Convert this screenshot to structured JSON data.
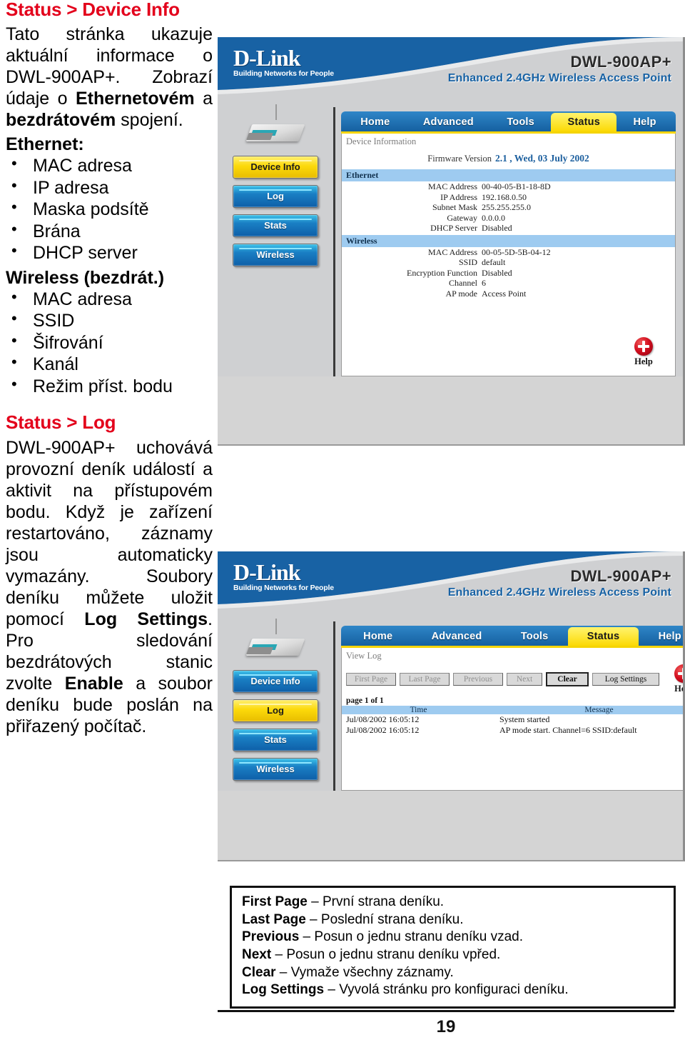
{
  "left_column": {
    "section1": {
      "heading": "Status > Device Info",
      "paragraph_html": "Tato stránka ukazuje aktuální informace o DWL-900AP+. Zobrazí údaje o <b>Ethernetovém</b> a <b>bezdrátovém</b> spojení.",
      "ethernet_heading": "Ethernet:",
      "ethernet_items": [
        "MAC adresa",
        "IP adresa",
        "Maska podsítě",
        "Brána",
        "DHCP server"
      ],
      "wireless_heading": "Wireless (bezdrát.)",
      "wireless_items": [
        "MAC adresa",
        "SSID",
        "Šifrování",
        "Kanál",
        "Režim příst. bodu"
      ]
    },
    "section2": {
      "heading": "Status > Log",
      "paragraph_html": "DWL-900AP+ uchovává provozní deník událostí a aktivit na přístupovém bodu. Když je zařízení restartováno, záznamy jsou automaticky vymazány. Soubory deníku můžete uložit pomocí <b>Log Settings</b>. Pro sledování bezdrátových stanic zvolte <b>Enable</b> a soubor deníku bude poslán na přiřazený počítač."
    }
  },
  "screenshot_device": {
    "brand": {
      "logo_main": "D-Link",
      "logo_tagline": "Building Networks for People"
    },
    "model": {
      "name": "DWL-900AP+",
      "subtitle": "Enhanced 2.4GHz Wireless Access Point"
    },
    "tabs": [
      {
        "label": "Home",
        "active": false
      },
      {
        "label": "Advanced",
        "active": false
      },
      {
        "label": "Tools",
        "active": false
      },
      {
        "label": "Status",
        "active": true
      },
      {
        "label": "Help",
        "active": false
      }
    ],
    "sidebar": [
      {
        "label": "Device Info",
        "active": true
      },
      {
        "label": "Log",
        "active": false
      },
      {
        "label": "Stats",
        "active": false
      },
      {
        "label": "Wireless",
        "active": false
      }
    ],
    "panel_title": "Device Information",
    "firmware_label": "Firmware Version",
    "firmware_value": "2.1 , Wed, 03 July 2002",
    "ethernet_group": "Ethernet",
    "ethernet_rows": [
      {
        "key": "MAC Address",
        "value": "00-40-05-B1-18-8D"
      },
      {
        "key": "IP Address",
        "value": "192.168.0.50"
      },
      {
        "key": "Subnet Mask",
        "value": "255.255.255.0"
      },
      {
        "key": "Gateway",
        "value": "0.0.0.0"
      },
      {
        "key": "DHCP Server",
        "value": "Disabled"
      }
    ],
    "wireless_group": "Wireless",
    "wireless_rows": [
      {
        "key": "MAC Address",
        "value": "00-05-5D-5B-04-12"
      },
      {
        "key": "SSID",
        "value": "default"
      },
      {
        "key": "Encryption Function",
        "value": "Disabled"
      },
      {
        "key": "Channel",
        "value": "6"
      },
      {
        "key": "AP mode",
        "value": "Access Point"
      }
    ],
    "help_label": "Help"
  },
  "screenshot_log": {
    "brand": {
      "logo_main": "D-Link",
      "logo_tagline": "Building Networks for People"
    },
    "model": {
      "name": "DWL-900AP+",
      "subtitle": "Enhanced 2.4GHz Wireless Access Point"
    },
    "tabs": [
      {
        "label": "Home",
        "active": false
      },
      {
        "label": "Advanced",
        "active": false
      },
      {
        "label": "Tools",
        "active": false
      },
      {
        "label": "Status",
        "active": true
      },
      {
        "label": "Help",
        "active": false
      }
    ],
    "sidebar": [
      {
        "label": "Device Info",
        "active": false
      },
      {
        "label": "Log",
        "active": true
      },
      {
        "label": "Stats",
        "active": false
      },
      {
        "label": "Wireless",
        "active": false
      }
    ],
    "panel_title": "View Log",
    "toolbar": [
      {
        "label": "First Page",
        "enabled": false
      },
      {
        "label": "Last Page",
        "enabled": false
      },
      {
        "label": "Previous",
        "enabled": false
      },
      {
        "label": "Next",
        "enabled": false
      },
      {
        "label": "Clear",
        "enabled": true,
        "focused": true
      },
      {
        "label": "Log Settings",
        "enabled": true
      }
    ],
    "page_info": "page 1 of 1",
    "columns": [
      "Time",
      "Message"
    ],
    "rows": [
      {
        "time": "Jul/08/2002 16:05:12",
        "message": "System started"
      },
      {
        "time": "Jul/08/2002 16:05:12",
        "message": "AP mode start. Channel=6 SSID:default"
      }
    ],
    "help_label": "Help"
  },
  "legend": [
    {
      "term": "First Page",
      "dash": " – ",
      "desc": "První strana deníku."
    },
    {
      "term": "Last Page",
      "dash": " – ",
      "desc": "Poslední strana deníku."
    },
    {
      "term": "Previous",
      "dash": " – ",
      "desc": "Posun o jednu stranu deníku vzad."
    },
    {
      "term": "Next",
      "dash": " – ",
      "desc": "Posun o jednu stranu deníku vpřed."
    },
    {
      "term": "Clear",
      "dash": " – ",
      "desc": "Vymaže všechny záznamy."
    },
    {
      "term": "Log Settings",
      "dash": " – ",
      "desc": "Vyvolá stránku pro konfiguraci deníku."
    }
  ],
  "footer": {
    "page_number": "19"
  },
  "colors": {
    "heading_red": "#e3001b",
    "brand_blue": "#1862a4",
    "tab_active_yellow": "#fbd905",
    "group_header_blue": "#9ecbf0",
    "help_red": "#d40f1f"
  }
}
